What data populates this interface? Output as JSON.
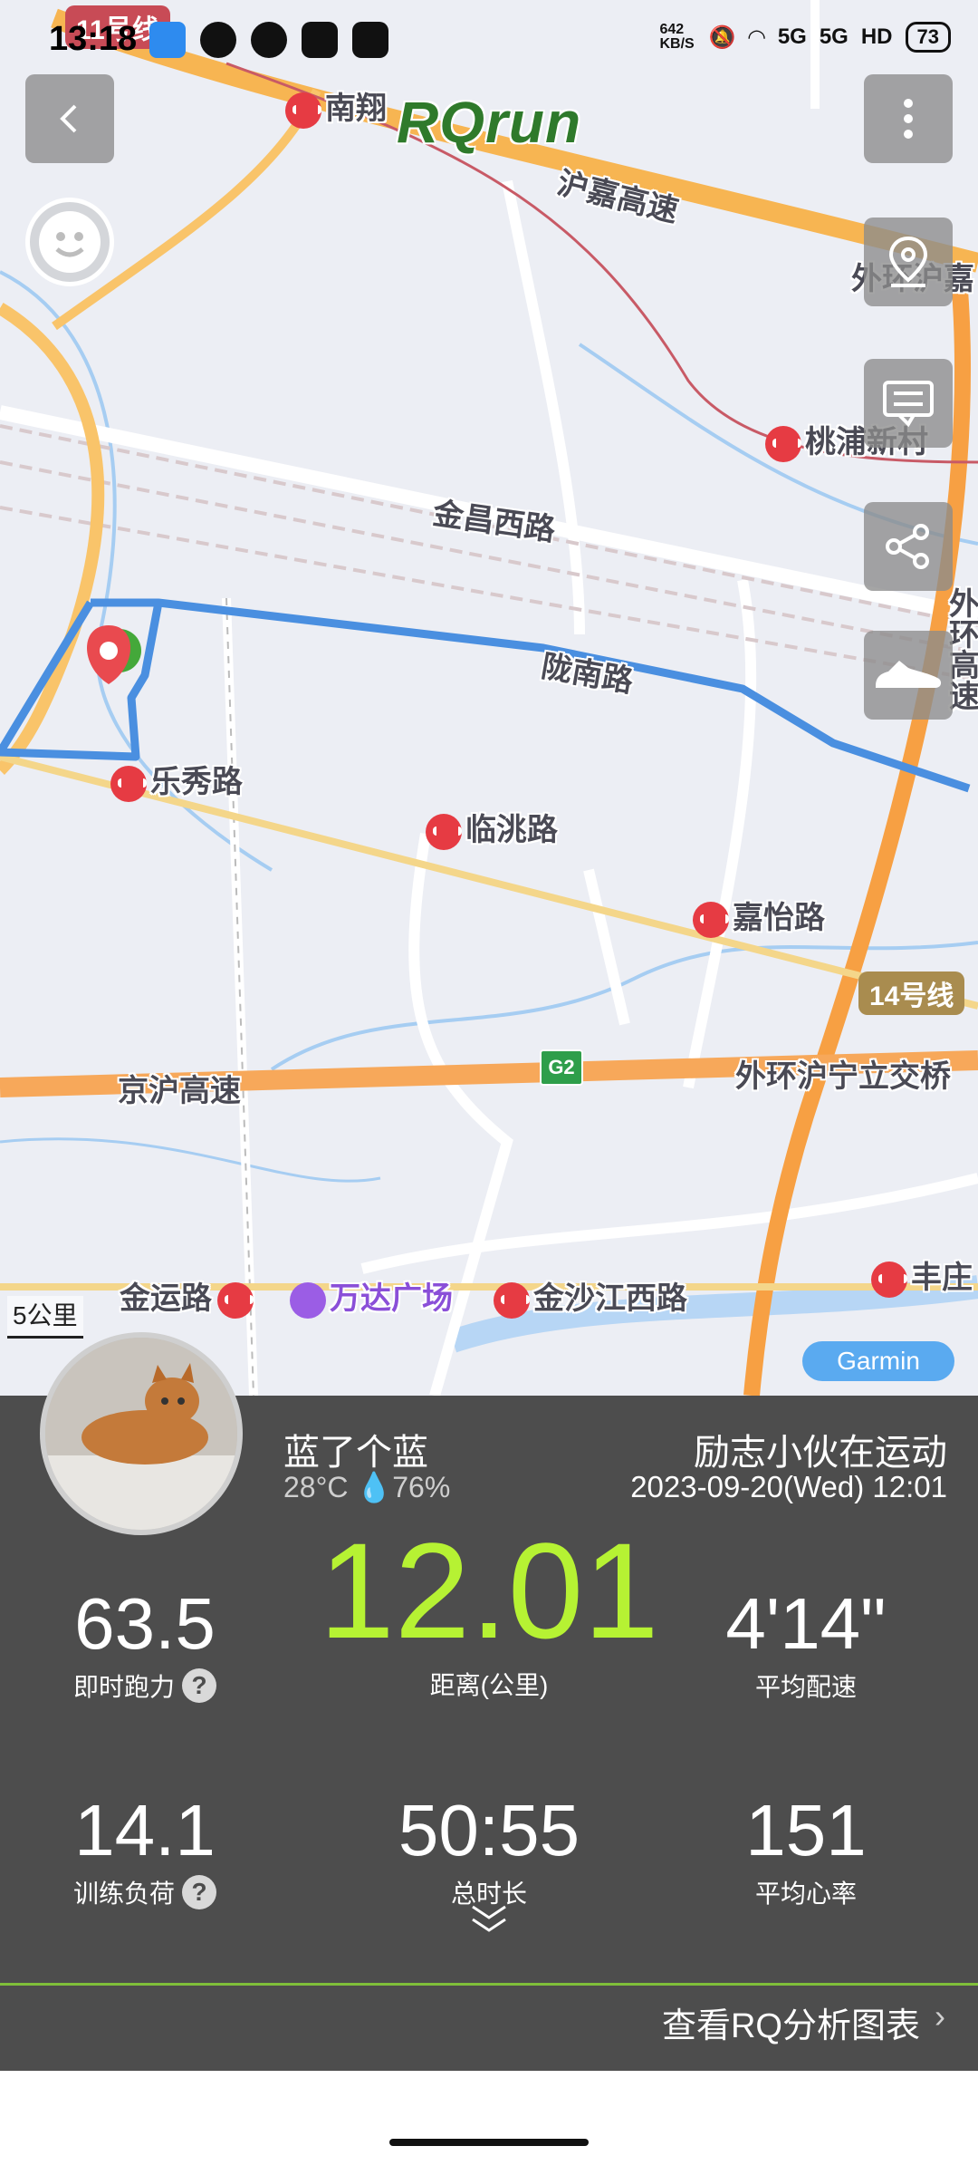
{
  "status_bar": {
    "time": "13:18",
    "network_speed": "642 KB/S",
    "signal_1": "5G",
    "signal_2": "5G",
    "hd": "HD",
    "battery": "73"
  },
  "map": {
    "brand": "RQrun",
    "metro_line_badges": [
      "11号线",
      "14号线"
    ],
    "road_labels": [
      "沪嘉高速",
      "金昌西路",
      "陇南路",
      "京沪高速",
      "外环沪宁立交桥",
      "外环沪嘉",
      "外环高速"
    ],
    "highway_shield": "G2",
    "stations": [
      "南翔",
      "桃浦新村",
      "乐秀路",
      "临洮路",
      "嘉怡路",
      "金运路",
      "金沙江西路",
      "丰庄"
    ],
    "poi": "万达广场",
    "scale_label": "5公里",
    "attribution": "Garmin",
    "route_color": "#4a8fe0"
  },
  "summary": {
    "user_name": "蓝了个蓝",
    "weather": "28°C 💧76%",
    "activity_title": "励志小伙在运动",
    "datetime": "2023-09-20(Wed) 12:01",
    "distance": "12.01",
    "distance_label": "距离(公里)",
    "running_power": "63.5",
    "running_power_label": "即时跑力",
    "avg_pace": "4'14\"",
    "avg_pace_label": "平均配速",
    "training_load": "14.1",
    "training_load_label": "训练负荷",
    "total_time": "50:55",
    "total_time_label": "总时长",
    "avg_hr": "151",
    "avg_hr_label": "平均心率",
    "analysis_link": "查看RQ分析图表",
    "accent_color": "#b6f233"
  }
}
